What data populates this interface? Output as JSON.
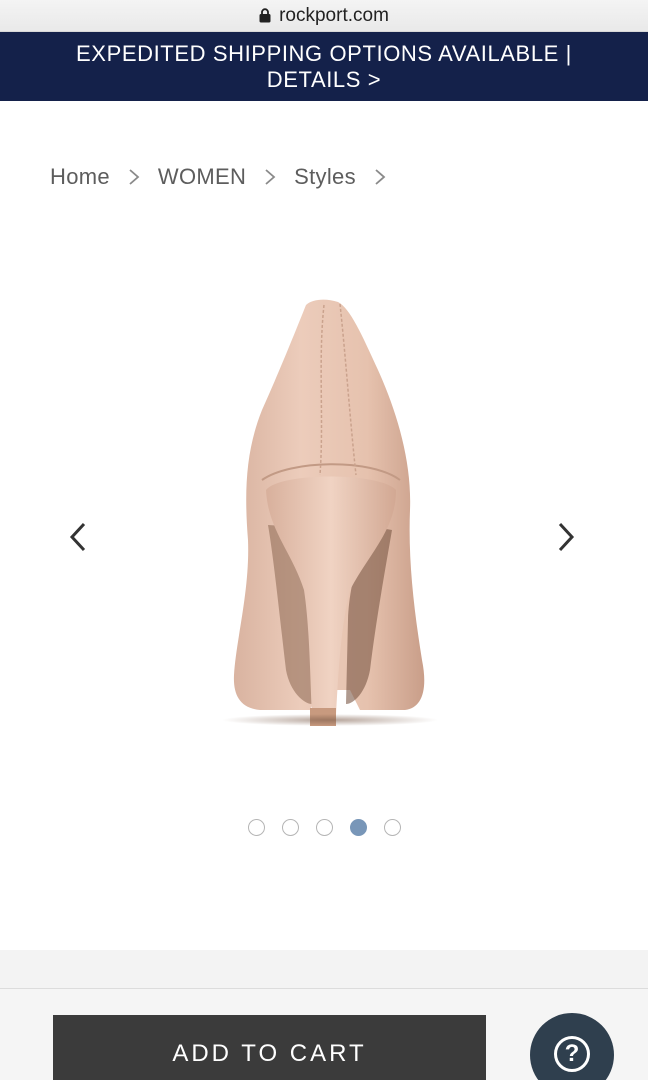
{
  "browser": {
    "url": "rockport.com",
    "lock_icon": "lock-icon"
  },
  "promo": {
    "line1": "EXPEDITED SHIPPING OPTIONS AVAILABLE |",
    "line2": "DETAILS >",
    "background": "#14214a"
  },
  "breadcrumb": {
    "items": [
      "Home",
      "WOMEN",
      "Styles"
    ],
    "separator_icon": "chevron-right-icon"
  },
  "carousel": {
    "prev_icon": "chevron-left-icon",
    "next_icon": "chevron-right-icon",
    "image": "beige-high-heel-pump-rear-view",
    "dots": 5,
    "active_dot": 4,
    "active_color": "#7896b8"
  },
  "cart": {
    "add_to_cart_label": "ADD TO CART",
    "button_color": "#3b3b3b"
  },
  "help": {
    "icon": "question-icon",
    "symbol": "?",
    "color": "#2f3f4e"
  }
}
